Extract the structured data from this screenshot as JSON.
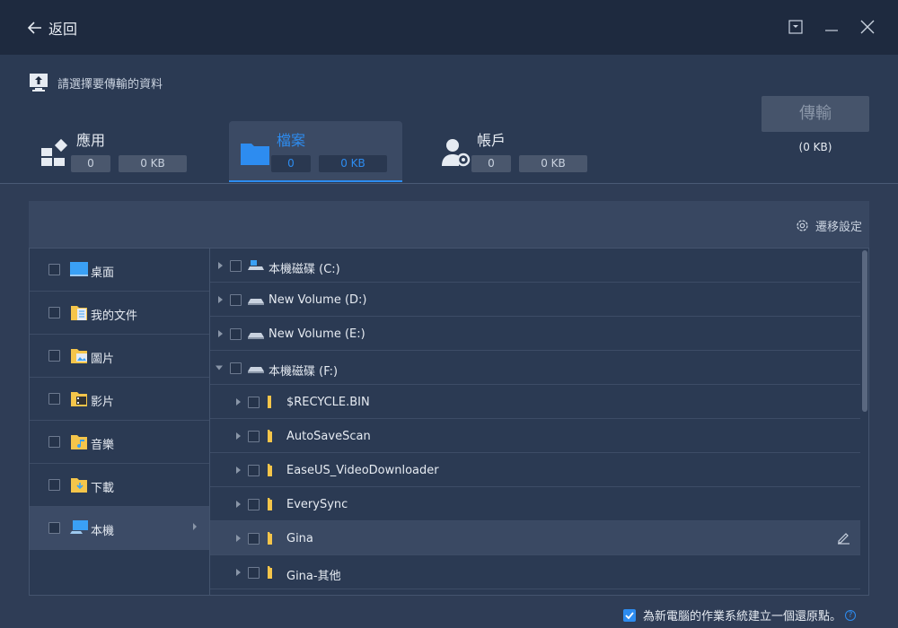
{
  "titlebar": {
    "back_label": "返回"
  },
  "header": {
    "hint": "請選擇要傳輸的資料",
    "categories": [
      {
        "label": "應用",
        "count": "0",
        "size": "0 KB",
        "icon": "apps-icon",
        "active": false
      },
      {
        "label": "檔案",
        "count": "0",
        "size": "0 KB",
        "icon": "folder-icon",
        "active": true
      },
      {
        "label": "帳戶",
        "count": "0",
        "size": "0 KB",
        "icon": "user-settings-icon",
        "active": false
      }
    ],
    "transfer_label": "傳輸",
    "transfer_size": "(0 KB)"
  },
  "panel": {
    "settings_label": "遷移設定",
    "left_items": [
      {
        "label": "桌面",
        "icon": "desktop-icon"
      },
      {
        "label": "我的文件",
        "icon": "documents-icon"
      },
      {
        "label": "圖片",
        "icon": "pictures-icon"
      },
      {
        "label": "影片",
        "icon": "videos-icon"
      },
      {
        "label": "音樂",
        "icon": "music-icon"
      },
      {
        "label": "下載",
        "icon": "downloads-icon"
      },
      {
        "label": "本機",
        "icon": "computer-icon",
        "selected": true
      }
    ],
    "tree_items": [
      {
        "label": "本機磁碟 (C:)",
        "icon": "system-drive-icon",
        "level": 0,
        "expanded": false
      },
      {
        "label": "New Volume (D:)",
        "icon": "drive-icon",
        "level": 0,
        "expanded": false
      },
      {
        "label": "New Volume (E:)",
        "icon": "drive-icon",
        "level": 0,
        "expanded": false
      },
      {
        "label": "本機磁碟 (F:)",
        "icon": "drive-icon",
        "level": 0,
        "expanded": true
      },
      {
        "label": "$RECYCLE.BIN",
        "icon": "folder-icon",
        "level": 1,
        "expanded": false
      },
      {
        "label": "AutoSaveScan",
        "icon": "folder-icon",
        "level": 1,
        "expanded": false
      },
      {
        "label": "EaseUS_VideoDownloader",
        "icon": "folder-icon",
        "level": 1,
        "expanded": false
      },
      {
        "label": "EverySync",
        "icon": "folder-icon",
        "level": 1,
        "expanded": false
      },
      {
        "label": "Gina",
        "icon": "folder-icon",
        "level": 1,
        "expanded": false,
        "hover": true
      },
      {
        "label": "Gina-其他",
        "icon": "folder-icon",
        "level": 1,
        "expanded": false
      }
    ]
  },
  "footer": {
    "restore_point_label": "為新電腦的作業系統建立一個還原點。",
    "restore_point_checked": true,
    "help": "?"
  },
  "colors": {
    "accent": "#2d8cf0",
    "titlebar": "#1e2a3f",
    "background": "#2f3d56",
    "folder": "#f5c54a"
  }
}
